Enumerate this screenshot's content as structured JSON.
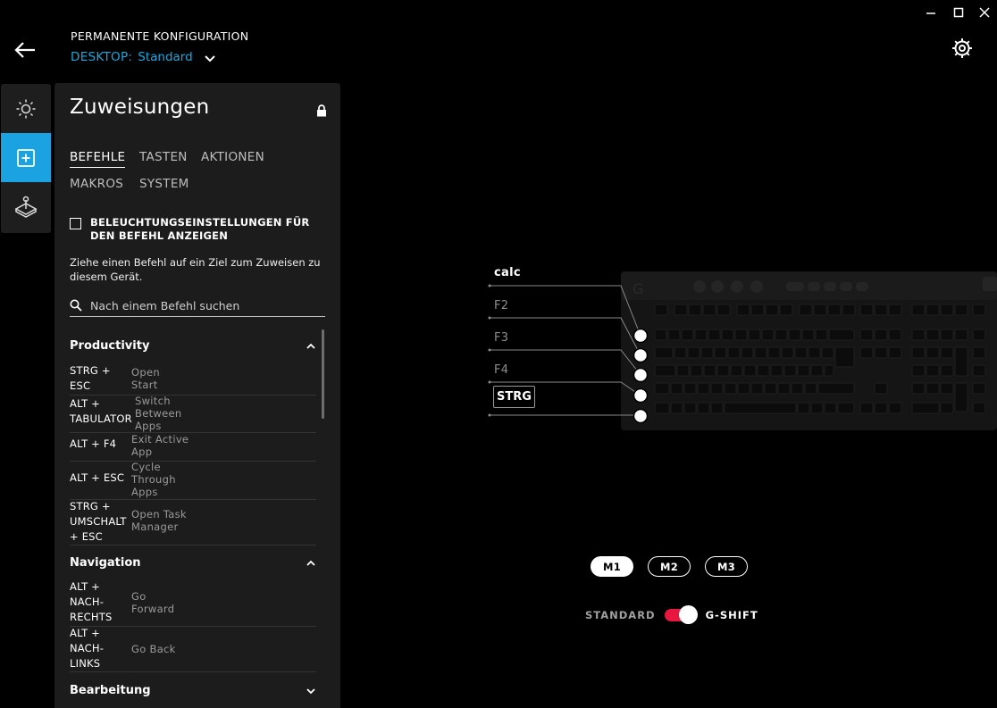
{
  "window": {
    "minimize": "—",
    "maximize": "☐",
    "close": "✕"
  },
  "header": {
    "config_label": "PERMANENTE KONFIGURATION",
    "device_label": "DESKTOP:",
    "profile_name": "Standard"
  },
  "panel": {
    "title": "Zuweisungen",
    "tabs": [
      {
        "label": "BEFEHLE",
        "active": true
      },
      {
        "label": "TASTEN",
        "active": false
      },
      {
        "label": "AKTIONEN",
        "active": false
      },
      {
        "label": "MAKROS",
        "active": false
      },
      {
        "label": "SYSTEM",
        "active": false
      }
    ],
    "checkbox_label": "BELEUCHTUNGSEINSTELLUNGEN FÜR DEN BEFEHL ANZEIGEN",
    "hint": "Ziehe einen Befehl auf ein Ziel zum Zuweisen zu diesem Gerät.",
    "search_placeholder": "Nach einem Befehl suchen",
    "sections": [
      {
        "title": "Productivity",
        "items": [
          {
            "key": "STRG + ESC",
            "action": "Open Start"
          },
          {
            "key": "ALT + TABULATOR",
            "action": "Switch Between Apps"
          },
          {
            "key": "ALT + F4",
            "action": "Exit Active App"
          },
          {
            "key": "ALT + ESC",
            "action": "Cycle Through Apps"
          },
          {
            "key": "STRG + UMSCHALT + ESC",
            "action": "Open Task Manager"
          }
        ]
      },
      {
        "title": "Navigation",
        "items": [
          {
            "key": "ALT + NACH-RECHTS",
            "action": "Go Forward"
          },
          {
            "key": "ALT + NACH-LINKS",
            "action": "Go Back"
          }
        ]
      },
      {
        "title": "Bearbeitung",
        "items": []
      }
    ]
  },
  "keyboard": {
    "callouts": [
      "calc",
      "F2",
      "F3",
      "F4",
      "STRG"
    ]
  },
  "modes": {
    "buttons": [
      {
        "label": "M1",
        "active": true
      },
      {
        "label": "M2",
        "active": false
      },
      {
        "label": "M3",
        "active": false
      }
    ],
    "standard_label": "STANDARD",
    "gshift_label": "G-SHIFT",
    "gshift_on": true,
    "toggle_color": "#e8173f"
  },
  "colors": {
    "accent": "#1aa3e0",
    "device_text": "#19a8e0"
  }
}
